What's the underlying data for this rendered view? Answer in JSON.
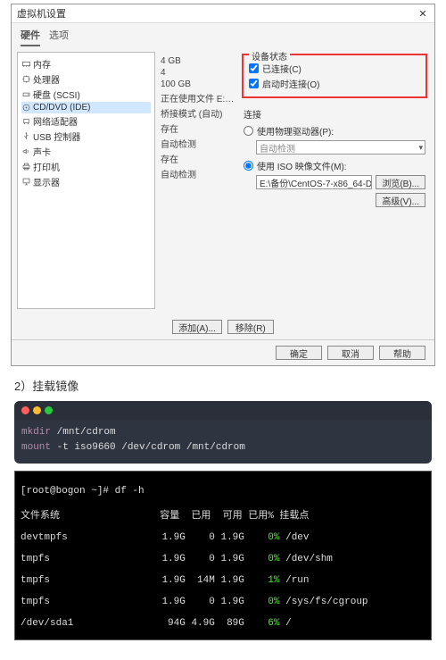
{
  "dialog": {
    "title": "虚拟机设置",
    "tabs": {
      "hardware": "硬件",
      "options": "选项"
    },
    "hardware": [
      {
        "icon": "memory-icon",
        "label": "内存",
        "summary": "4 GB"
      },
      {
        "icon": "cpu-icon",
        "label": "处理器",
        "summary": "4"
      },
      {
        "icon": "disk-icon",
        "label": "硬盘 (SCSI)",
        "summary": "100 GB"
      },
      {
        "icon": "cd-icon",
        "label": "CD/DVD (IDE)",
        "summary": "正在使用文件 E:\\备份\\CentOS..."
      },
      {
        "icon": "nic-icon",
        "label": "网络适配器",
        "summary": "桥接模式 (自动)"
      },
      {
        "icon": "usb-icon",
        "label": "USB 控制器",
        "summary": "存在"
      },
      {
        "icon": "sound-icon",
        "label": "声卡",
        "summary": "自动检测"
      },
      {
        "icon": "printer-icon",
        "label": "打印机",
        "summary": "存在"
      },
      {
        "icon": "display-icon",
        "label": "显示器",
        "summary": "自动检测"
      }
    ],
    "device_status": {
      "title": "设备状态",
      "connected": "已连接(C)",
      "connect_at_power_on": "启动时连接(O)"
    },
    "connection": {
      "title": "连接",
      "use_physical": "使用物理驱动器(P):",
      "auto_detect": "自动检测",
      "use_iso": "使用 ISO 映像文件(M):",
      "iso_value": "E:\\备份\\CentOS-7-x86_64-D"
    },
    "buttons": {
      "browse": "浏览(B)...",
      "advanced": "高级(V)...",
      "add": "添加(A)...",
      "remove": "移除(R)",
      "ok": "确定",
      "cancel": "取消",
      "help": "帮助"
    }
  },
  "step2": "2）挂载镜像",
  "term": {
    "line1": {
      "kw": "mkdir",
      "rest": " /mnt/cdrom"
    },
    "line2": {
      "kw": "mount",
      "rest": " -t iso9660 /dev/cdrom /mnt/cdrom"
    }
  },
  "df": {
    "prompt": "[root@bogon ~]# df -h",
    "header": "文件系统                 容量  已用  可用 已用% 挂载点",
    "rows": [
      {
        "fs": "devtmpfs               ",
        "size": "1.9G",
        "used": "   0",
        "avail": "1.9G",
        "pct": "   0%",
        "mnt": " /dev"
      },
      {
        "fs": "tmpfs                  ",
        "size": "1.9G",
        "used": "   0",
        "avail": "1.9G",
        "pct": "   0%",
        "mnt": " /dev/shm"
      },
      {
        "fs": "tmpfs                  ",
        "size": "1.9G",
        "used": " 14M",
        "avail": "1.9G",
        "pct": "   1%",
        "mnt": " /run"
      },
      {
        "fs": "tmpfs                  ",
        "size": "1.9G",
        "used": "   0",
        "avail": "1.9G",
        "pct": "   0%",
        "mnt": " /sys/fs/cgroup"
      },
      {
        "fs": "/dev/sda1              ",
        "size": " 94G",
        "used": "4.9G",
        "avail": " 89G",
        "pct": "   6%",
        "mnt": " /"
      }
    ]
  }
}
